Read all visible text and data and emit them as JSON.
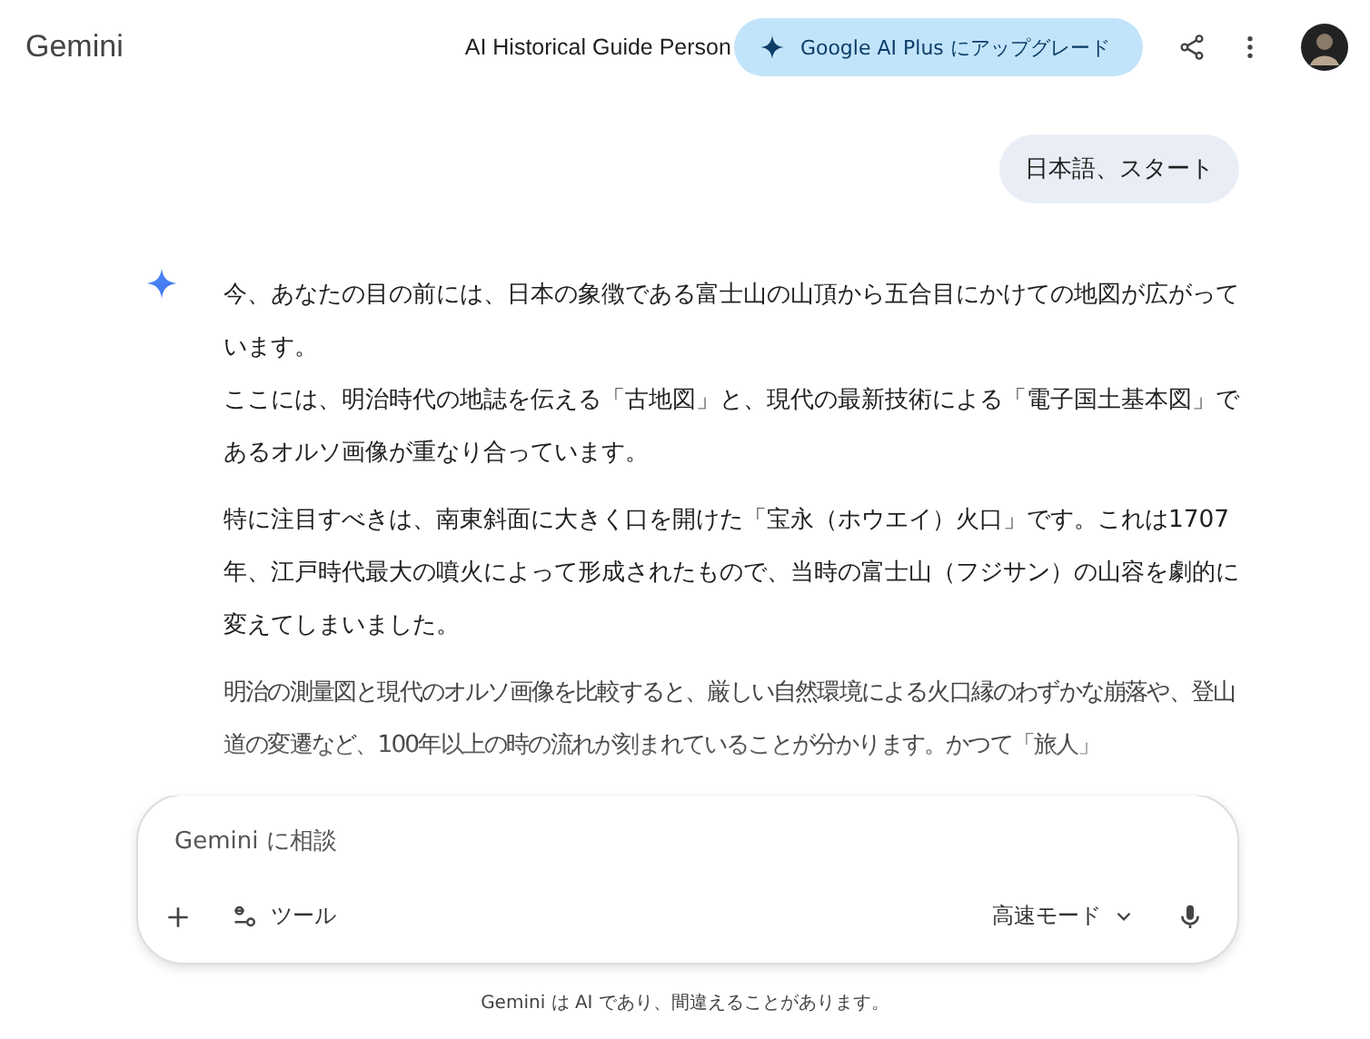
{
  "header": {
    "app_name": "Gemini",
    "chat_title": "AI Historical Guide Person",
    "upgrade_button": "Google AI Plus にアップグレード"
  },
  "messages": [
    {
      "kind": "user",
      "text": "日本語、スタート"
    },
    {
      "kind": "model",
      "paragraphs": [
        [
          "今、あなたの目の前には、日本の象徴である富士山の山頂から五合目にかけての地図が広がっています。",
          "ここには、明治時代の地誌を伝える「古地図」と、現代の最新技術による「電子国土基本図」であるオルソ画像が重なり合っています。"
        ],
        [
          "特に注目すべきは、南東斜面に大きく口を開けた「宝永（ホウエイ）火口」です。これは1707年、江戸時代最大の噴火によって形成されたもので、当時の富士山（フジサン）の山容を劇的に変えてしまいました。"
        ],
        [
          "明治の測量図と現代のオルソ画像を比較すると、厳しい自然環境による火口縁のわずかな崩落や、登山道の変遷など、100年以上の時の流れが刻まれていることが分かります。かつて「旅人」"
        ]
      ]
    }
  ],
  "composer": {
    "placeholder": "Gemini に相談",
    "tools_button": "ツール",
    "mode_button": "高速モード"
  },
  "disclaimer": "Gemini は AI であり、間違えることがあります。"
}
